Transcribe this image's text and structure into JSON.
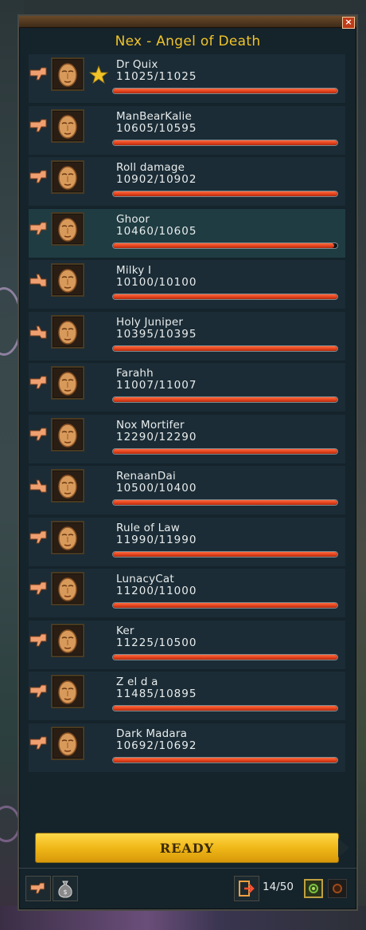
{
  "window": {
    "title": "Nex - Angel of Death",
    "close_label": "×"
  },
  "players": [
    {
      "name": "Dr Quix",
      "hp": "11025/11025",
      "hp_fraction": 1.0,
      "thumb": "thumbs-down",
      "leader": true,
      "selected": false
    },
    {
      "name": "ManBearKalie",
      "hp": "10605/10595",
      "hp_fraction": 1.0,
      "thumb": "thumbs-down",
      "leader": false,
      "selected": false
    },
    {
      "name": "Roll damage",
      "hp": "10902/10902",
      "hp_fraction": 1.0,
      "thumb": "thumbs-down",
      "leader": false,
      "selected": false
    },
    {
      "name": "Ghoor",
      "hp": "10460/10605",
      "hp_fraction": 0.986,
      "thumb": "thumbs-down",
      "leader": false,
      "selected": true
    },
    {
      "name": "Milky I",
      "hp": "10100/10100",
      "hp_fraction": 1.0,
      "thumb": "thumbs-up",
      "leader": false,
      "selected": false
    },
    {
      "name": "Holy Juniper",
      "hp": "10395/10395",
      "hp_fraction": 1.0,
      "thumb": "thumbs-up",
      "leader": false,
      "selected": false
    },
    {
      "name": "Farahh",
      "hp": "11007/11007",
      "hp_fraction": 1.0,
      "thumb": "thumbs-down",
      "leader": false,
      "selected": false
    },
    {
      "name": "Nox Mortifer",
      "hp": "12290/12290",
      "hp_fraction": 1.0,
      "thumb": "thumbs-down",
      "leader": false,
      "selected": false
    },
    {
      "name": "RenaanDai",
      "hp": "10500/10400",
      "hp_fraction": 1.0,
      "thumb": "thumbs-up",
      "leader": false,
      "selected": false
    },
    {
      "name": "Rule of Law",
      "hp": "11990/11990",
      "hp_fraction": 1.0,
      "thumb": "thumbs-down",
      "leader": false,
      "selected": false
    },
    {
      "name": "LunacyCat",
      "hp": "11200/11000",
      "hp_fraction": 1.0,
      "thumb": "thumbs-down",
      "leader": false,
      "selected": false
    },
    {
      "name": "Ker",
      "hp": "11225/10500",
      "hp_fraction": 1.0,
      "thumb": "thumbs-down",
      "leader": false,
      "selected": false
    },
    {
      "name": "Z el d a",
      "hp": "11485/10895",
      "hp_fraction": 1.0,
      "thumb": "thumbs-down",
      "leader": false,
      "selected": false
    },
    {
      "name": "Dark Madara",
      "hp": "10692/10692",
      "hp_fraction": 1.0,
      "thumb": "thumbs-down",
      "leader": false,
      "selected": false
    }
  ],
  "ready_button": {
    "label": "READY"
  },
  "footer": {
    "player_count": "14/50",
    "buttons": [
      "thumbs-down-icon",
      "money-bag-icon",
      "leave-icon"
    ],
    "toggles": [
      {
        "name": "green-toggle-icon",
        "active": true
      },
      {
        "name": "orange-toggle-icon",
        "active": false
      }
    ]
  },
  "colors": {
    "title": "#f0c428",
    "hp_bar": "#e0401a",
    "ready": "#f0b818",
    "panel": "#15232b",
    "row": "#1b2c36",
    "row_selected": "#1f3c42"
  }
}
